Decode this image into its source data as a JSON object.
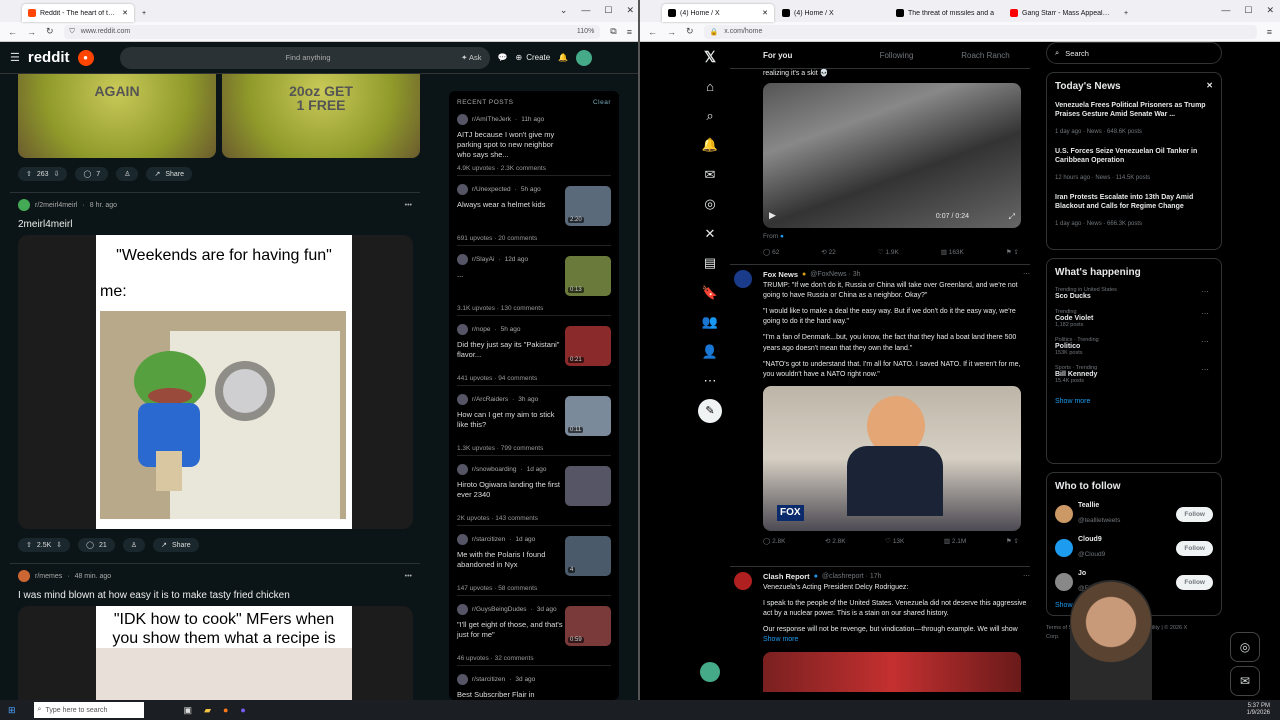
{
  "left_browser": {
    "tabs": [
      {
        "title": "Reddit - The heart of the intern"
      }
    ],
    "url": "www.reddit.com",
    "zoom": "110%"
  },
  "reddit": {
    "logo": "reddit",
    "search_placeholder": "Find anything",
    "ask": "Ask",
    "create": "Create",
    "post1": {
      "cap_left": "AGAIN",
      "cap_right": "20oz GET\n1 FREE",
      "votes": "263",
      "comments": "7",
      "share": "Share"
    },
    "post2": {
      "sub": "r/2meirl4meirl",
      "time": "8 hr. ago",
      "title": "2meirl4meirl",
      "meme_top": "\"Weekends are for having fun\"",
      "meme_me": "me:",
      "votes": "2.5K",
      "comments": "21",
      "share": "Share"
    },
    "post3": {
      "sub": "r/memes",
      "time": "48 min. ago",
      "title": "I was mind blown at how easy it is to make tasty fried chicken",
      "meme_top": "\"IDK how to cook\" MFers when you show them what a recipe is"
    },
    "recent": {
      "heading": "RECENT POSTS",
      "clear": "Clear",
      "items": [
        {
          "sub": "r/AmITheJerk",
          "time": "11h ago",
          "title": "AITJ because I won't give my parking spot to new neighbor who says she...",
          "stats": "4.9K upvotes · 2.3K comments",
          "thumb": ""
        },
        {
          "sub": "r/Unexpected",
          "time": "5h ago",
          "title": "Always wear a helmet kids",
          "stats": "691 upvotes · 20 comments",
          "thumb": "2:20"
        },
        {
          "sub": "r/SlayAi",
          "time": "12d ago",
          "title": "...",
          "stats": "3.1K upvotes · 130 comments",
          "thumb": "0:13"
        },
        {
          "sub": "r/nope",
          "time": "5h ago",
          "title": "Did they just say its \"Pakistani\" flavor...",
          "stats": "441 upvotes · 94 comments",
          "thumb": "0:21"
        },
        {
          "sub": "r/ArcRaiders",
          "time": "3h ago",
          "title": "How can I get my aim to stick like this?",
          "stats": "1.3K upvotes · 799 comments",
          "thumb": "0:11"
        },
        {
          "sub": "r/snowboarding",
          "time": "1d ago",
          "title": "Hiroto Ogiwara landing the first ever 2340",
          "stats": "2K upvotes · 143 comments",
          "thumb": ""
        },
        {
          "sub": "r/starcitizen",
          "time": "1d ago",
          "title": "Me with the Polaris I found abandoned in Nyx",
          "stats": "147 upvotes · 58 comments",
          "thumb": "4"
        },
        {
          "sub": "r/GuysBeingDudes",
          "time": "3d ago",
          "title": "\"I'll get eight of those, and that's just for me\"",
          "stats": "46 upvotes · 32 comments",
          "thumb": "0:59"
        },
        {
          "sub": "r/starcitizen",
          "time": "3d ago",
          "title": "Best Subscriber Flair in",
          "stats": "",
          "thumb": ""
        }
      ]
    }
  },
  "right_browser": {
    "tabs": [
      {
        "title": "(4) Home / X"
      },
      {
        "title": "(4) Home / X"
      },
      {
        "title": "The threat of missiles and a"
      },
      {
        "title": "Gang Starr - Mass Appeal - You"
      }
    ],
    "url": "x.com/home"
  },
  "x": {
    "tabs": [
      "For you",
      "Following",
      "Roach Ranch"
    ],
    "tweet1": {
      "text_top": "realizing it's a skit 💀",
      "time": "0:07 / 0:24",
      "from": "From",
      "replies": "62",
      "reposts": "22",
      "likes": "1.9K",
      "views": "163K"
    },
    "tweet2": {
      "name": "Fox News",
      "handle": "@FoxNews · 3h",
      "p1": "TRUMP: \"If we don't do it, Russia or China will take over Greenland, and we're not going to have Russia or China as a neighbor. Okay?\"",
      "p2": "\"I would like to make a deal the easy way. But if we don't do it the easy way, we're going to do it the hard way.\"",
      "p3": "\"I'm a fan of Denmark...but, you know, the fact that they had a boat land there 500 years ago doesn't mean that they own the land.\"",
      "p4": "\"NATO's got to understand that. I'm all for NATO. I saved NATO. If it weren't for me, you wouldn't have a NATO right now.\"",
      "replies": "2.8K",
      "reposts": "2.8K",
      "likes": "13K",
      "views": "2.1M"
    },
    "tweet3": {
      "name": "Clash Report",
      "handle": "@clashreport · 17h",
      "p1": "Venezuela's Acting President Delcy Rodriguez:",
      "p2": "I speak to the people of the United States. Venezuela did not deserve this aggressive act by a nuclear power. This is a stain on our shared history.",
      "p3": "Our response will not be revenge, but vindication—through example. We will show",
      "more": "Show more"
    },
    "search": "Search",
    "news": {
      "title": "Today's News",
      "items": [
        {
          "t": "Venezuela Frees Political Prisoners as Trump Praises Gesture Amid Senate War ...",
          "m": "1 day ago · News · 648.6K posts"
        },
        {
          "t": "U.S. Forces Seize Venezuelan Oil Tanker in Caribbean Operation",
          "m": "12 hours ago · News · 114.5K posts"
        },
        {
          "t": "Iran Protests Escalate into 13th Day Amid Blackout and Calls for Regime Change",
          "m": "1 day ago · News · 666.3K posts"
        }
      ]
    },
    "happening": {
      "title": "What's happening",
      "items": [
        {
          "c": "Trending in United States",
          "t": "Sco Ducks",
          "p": ""
        },
        {
          "c": "Trending",
          "t": "Code Violet",
          "p": "1,182 posts"
        },
        {
          "c": "Politics · Trending",
          "t": "Politico",
          "p": "153K posts"
        },
        {
          "c": "Sports · Trending",
          "t": "Bill Kennedy",
          "p": "15.4K posts"
        }
      ],
      "more": "Show more"
    },
    "follow": {
      "title": "Who to follow",
      "items": [
        {
          "n": "Teallie",
          "h": "@teallietweets",
          "b": "Follow"
        },
        {
          "n": "Cloud9",
          "h": "@Cloud9",
          "b": "Follow"
        },
        {
          "n": "Jo",
          "h": "@Flatkitt...",
          "b": "Follow"
        }
      ],
      "more": "Show more",
      "footer": "Terms of Service | Privacy Policy | Accessibility | © 2026 X Corp."
    }
  },
  "taskbar": {
    "search": "Type here to search",
    "time": "5:37 PM",
    "date": "1/9/2026"
  }
}
